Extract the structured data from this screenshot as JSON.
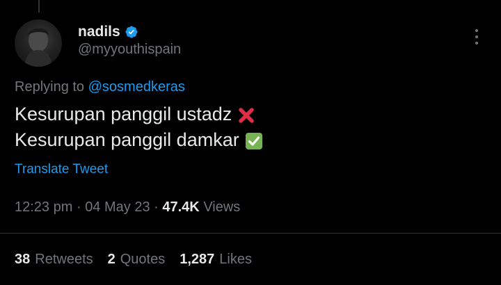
{
  "tweet": {
    "author": {
      "display_name": "nadils",
      "handle": "@myyouthispain",
      "verified": true,
      "avatar_icon": "avatar-photo"
    },
    "replying_to": {
      "prefix": "Replying to",
      "handle": "@sosmedkeras"
    },
    "text_lines": [
      {
        "text": "Kesurupan panggil ustadz",
        "emoji": "cross-mark-icon"
      },
      {
        "text": "Kesurupan panggil damkar",
        "emoji": "check-mark-button-icon"
      }
    ],
    "translate_label": "Translate Tweet",
    "time": "12:23 pm",
    "date": "04 May 23",
    "separator": "·",
    "views_count": "47.4K",
    "views_label": "Views",
    "stats": {
      "retweets_count": "38",
      "retweets_label": "Retweets",
      "quotes_count": "2",
      "quotes_label": "Quotes",
      "likes_count": "1,287",
      "likes_label": "Likes"
    }
  },
  "colors": {
    "background": "#000000",
    "primary_text": "#e7e9ea",
    "secondary_text": "#71767b",
    "accent": "#1d9bf0",
    "divider": "#2f3336",
    "cross_red": "#dd2e44",
    "check_green": "#77b255"
  }
}
